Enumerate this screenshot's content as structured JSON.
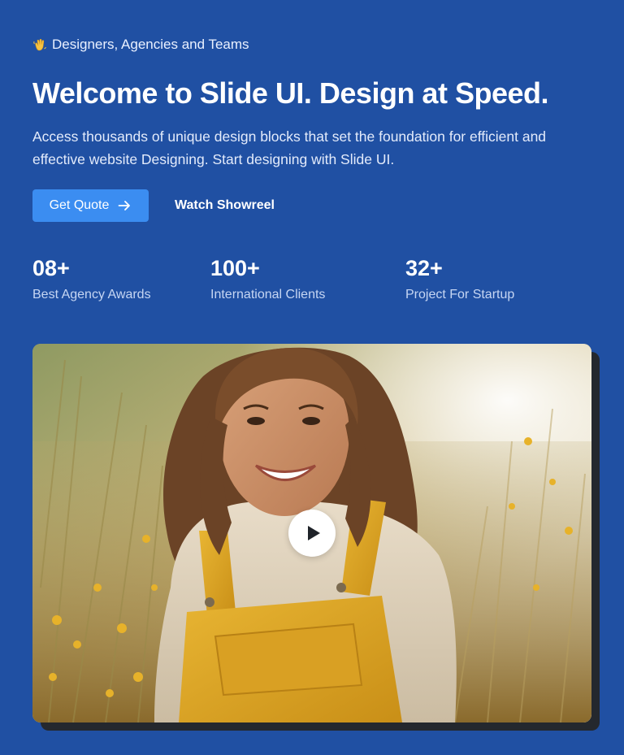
{
  "hero": {
    "eyebrow": {
      "icon": "waving-hand-icon",
      "text": "Designers, Agencies and Teams"
    },
    "title": "Welcome to Slide UI. Design at Speed.",
    "subtitle": "Access thousands of unique design blocks that set the foundation for efficient and effective website Designing. Start designing with Slide UI.",
    "actions": {
      "primary_label": "Get Quote",
      "primary_icon": "arrow-right-icon",
      "secondary_label": "Watch Showreel"
    },
    "stats": [
      {
        "value": "08+",
        "label": "Best Agency Awards"
      },
      {
        "value": "100+",
        "label": "International Clients"
      },
      {
        "value": "32+",
        "label": "Project For Startup"
      }
    ],
    "media": {
      "play_icon": "play-icon"
    }
  },
  "colors": {
    "background": "#2050a3",
    "primary_button": "#3b8df1",
    "stat_label": "#c6d6f3",
    "media_shadow": "#24282e"
  }
}
